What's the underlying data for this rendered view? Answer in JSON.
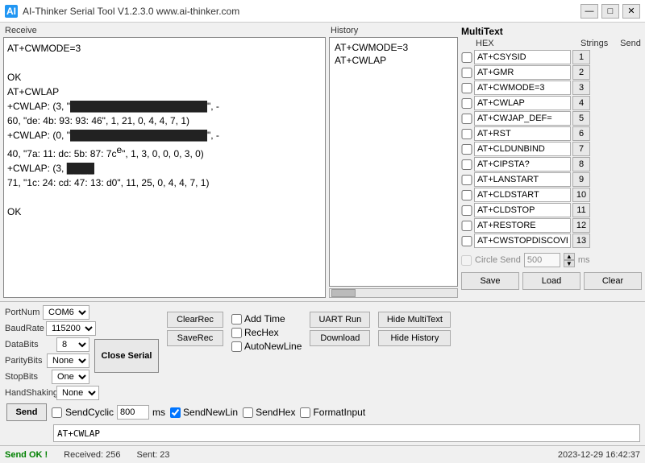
{
  "titleBar": {
    "title": "AI-Thinker Serial Tool V1.2.3.0  www.ai-thinker.com",
    "iconLabel": "AI",
    "minimizeLabel": "—",
    "maximizeLabel": "□",
    "closeLabel": "✕"
  },
  "receive": {
    "label": "Receive",
    "content_lines": [
      "AT+CWMODE=3",
      "",
      "OK",
      "AT+CWLAP",
      "+CWLAP: (3, \"[REDACTED]\", -",
      "60, \"de: 4b: 93: 93: 46\", 1, 21, 0, 4, 4, 7, 1)",
      "+CWLAP: (0, \"[REDACTED]\", -",
      "40, \"7a: 11: dc: 5b: 87: 7c\", 1, 3, 0, 0, 0, 3, 0)",
      "+CWLAP: (3,",
      "71, \"1c: 24: cd: 47: 13: d0\", 11, 25, 0, 4, 4, 7, 1)",
      "",
      "OK"
    ]
  },
  "history": {
    "label": "History",
    "items": [
      "AT+CWMODE=3",
      "AT+CWLAP"
    ]
  },
  "multitext": {
    "label": "MultiText",
    "hexLabel": "HEX",
    "stringsLabel": "Strings",
    "sendLabel": "Send",
    "rows": [
      {
        "id": 1,
        "checked": false,
        "value": "AT+CSYSID",
        "send": "1"
      },
      {
        "id": 2,
        "checked": false,
        "value": "AT+GMR",
        "send": "2"
      },
      {
        "id": 3,
        "checked": false,
        "value": "AT+CWMODE=3",
        "send": "3"
      },
      {
        "id": 4,
        "checked": false,
        "value": "AT+CWLAP",
        "send": "4"
      },
      {
        "id": 5,
        "checked": false,
        "value": "AT+CWJAP_DEF=\"newifi_",
        "send": "5"
      },
      {
        "id": 6,
        "checked": false,
        "value": "AT+RST",
        "send": "6"
      },
      {
        "id": 7,
        "checked": false,
        "value": "AT+CLDUNBIND",
        "send": "7"
      },
      {
        "id": 8,
        "checked": false,
        "value": "AT+CIPSTA?",
        "send": "8"
      },
      {
        "id": 9,
        "checked": false,
        "value": "AT+LANSTART",
        "send": "9"
      },
      {
        "id": 10,
        "checked": false,
        "value": "AT+CLDSTART",
        "send": "10"
      },
      {
        "id": 11,
        "checked": false,
        "value": "AT+CLDSTOP",
        "send": "11"
      },
      {
        "id": 12,
        "checked": false,
        "value": "AT+RESTORE",
        "send": "12"
      },
      {
        "id": 13,
        "checked": false,
        "value": "AT+CWSTOPDISCOVER",
        "send": "13"
      }
    ],
    "circleSend": {
      "label": "Circle Send",
      "value": "500",
      "msLabel": "ms",
      "checked": false,
      "disabled": true
    },
    "saveBtn": "Save",
    "loadBtn": "Load",
    "clearBtn": "Clear"
  },
  "controls": {
    "portNum": {
      "label": "PortNum",
      "value": "COM6"
    },
    "baudRate": {
      "label": "BaudRate",
      "value": "115200"
    },
    "dataBits": {
      "label": "DataBits",
      "value": "8"
    },
    "parityBits": {
      "label": "ParityBits",
      "value": "None"
    },
    "stopBits": {
      "label": "StopBits",
      "value": "One"
    },
    "handShaking": {
      "label": "HandShaking",
      "value": "None"
    },
    "closeSerial": "Close Serial",
    "clearRec": "ClearRec",
    "saveRec": "SaveRec",
    "addTime": {
      "label": "Add Time",
      "checked": false
    },
    "recHex": {
      "label": "RecHex",
      "checked": false
    },
    "autoNewLine": {
      "label": "AutoNewLine",
      "checked": false
    },
    "uartRun": "UART Run",
    "download": "Download",
    "hideMultiText": "Hide MultiText",
    "hideHistory": "Hide History",
    "sendCyclic": {
      "label": "SendCyclic",
      "checked": false
    },
    "cyclicMs": "800",
    "msLabel": "ms",
    "sendNewLine": {
      "label": "SendNewLin",
      "checked": true
    },
    "sendHex": {
      "label": "SendHex",
      "checked": false
    },
    "formatInput": {
      "label": "FormatInput",
      "checked": false
    },
    "sendBtn": "Send",
    "sendInput": "AT+CWLAP"
  },
  "statusBar": {
    "okText": "Send OK !",
    "received": "Received: 256",
    "sent": "Sent: 23",
    "datetime": "2023-12-29 16:42:37"
  }
}
